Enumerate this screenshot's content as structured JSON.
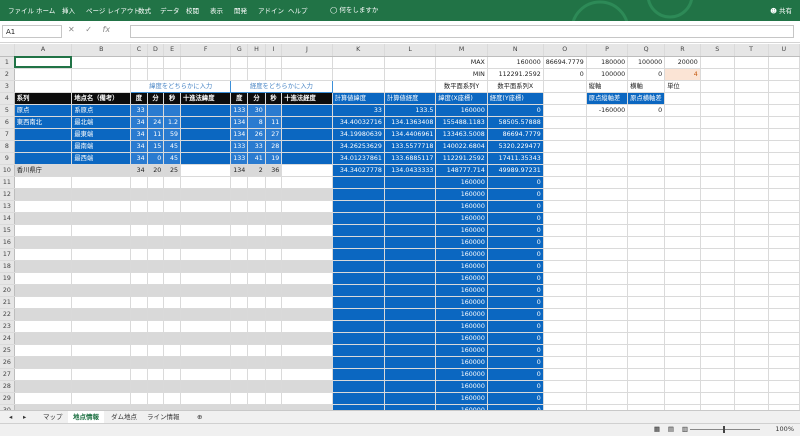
{
  "ribbon": {
    "menu": [
      "ファイル",
      "ホーム",
      "挿入",
      "ページ レイアウト",
      "数式",
      "データ",
      "校閲",
      "表示",
      "開発",
      "アドイン",
      "ヘルプ"
    ],
    "tellme": "何をしますか",
    "share": "共有"
  },
  "formula_bar": {
    "name_box": "A1",
    "fx": "fx",
    "value": ""
  },
  "columns": [
    "A",
    "B",
    "C",
    "D",
    "E",
    "F",
    "G",
    "H",
    "I",
    "J",
    "K",
    "L",
    "M",
    "N",
    "O",
    "P",
    "Q",
    "R",
    "S",
    "T",
    "U"
  ],
  "rows": {
    "r1": {
      "M": "MAX",
      "N1": "160000",
      "N2": "86694.7779",
      "P": "180000",
      "Q": "100000",
      "R": "20000"
    },
    "r2": {
      "M": "MIN",
      "N1": "112291.2592",
      "N2": "0",
      "P": "100000",
      "Q": "0",
      "R": "4"
    },
    "r3": {
      "C": "緯度をどちらかに入力",
      "G": "経度をどちらかに入力",
      "M": "数平面系列Y",
      "N": "数平面系列X",
      "P": "縦軸",
      "Q": "横軸",
      "R": "単位"
    },
    "r4": {
      "A": "系列",
      "B": "地点名（備考）",
      "C": "度",
      "D": "分",
      "E": "秒",
      "F": "十進法緯度",
      "G": "度",
      "H": "分",
      "I": "秒",
      "J": "十進法経度",
      "K": "計算値緯度",
      "L": "計算値経度",
      "M": "緯度(X座標)",
      "N": "経度(Y座標)",
      "P": "原点縦軸差",
      "Q": "原点横軸差"
    },
    "r5": {
      "A": "原点",
      "B": "系原点",
      "C": "33",
      "G": "133",
      "H": "30",
      "K": "33",
      "L": "133.5",
      "M": "160000",
      "N": "0",
      "P": "-160000",
      "Q": "0"
    },
    "r6": {
      "A": "東西南北",
      "B": "最北端",
      "C": "34",
      "D": "24",
      "E": "1.2",
      "G": "134",
      "H": "8",
      "I": "11",
      "K": "34.40032716",
      "L": "134.1363408",
      "M": "155488.1183",
      "N": "58505.57888"
    },
    "r7": {
      "B": "最東端",
      "C": "34",
      "D": "11",
      "E": "59",
      "G": "134",
      "H": "26",
      "I": "27",
      "K": "34.19980639",
      "L": "134.4406961",
      "M": "133463.5008",
      "N": "86694.7779"
    },
    "r8": {
      "B": "最南端",
      "C": "34",
      "D": "15",
      "E": "45",
      "G": "133",
      "H": "33",
      "I": "28",
      "K": "34.26253629",
      "L": "133.5577718",
      "M": "140022.6804",
      "N": "5320.229477"
    },
    "r9": {
      "B": "最西端",
      "C": "34",
      "D": "0",
      "E": "45",
      "G": "133",
      "H": "41",
      "I": "19",
      "K": "34.01237861",
      "L": "133.6885117",
      "M": "112291.2592",
      "N": "17411.35343"
    },
    "r10": {
      "A": "香川県庁",
      "C": "34",
      "D": "20",
      "E": "25",
      "G": "134",
      "H": "2",
      "I": "36",
      "K": "34.34027778",
      "L": "134.0433333",
      "M": "148777.714",
      "N": "49989.97231"
    },
    "empty_m": "160000",
    "empty_n": "0"
  },
  "sheet_tabs": [
    "マップ",
    "地点情報",
    "ダム地点",
    "ライン情報"
  ],
  "active_tab": "地点情報",
  "status": {
    "text": "",
    "zoom": "100%"
  }
}
